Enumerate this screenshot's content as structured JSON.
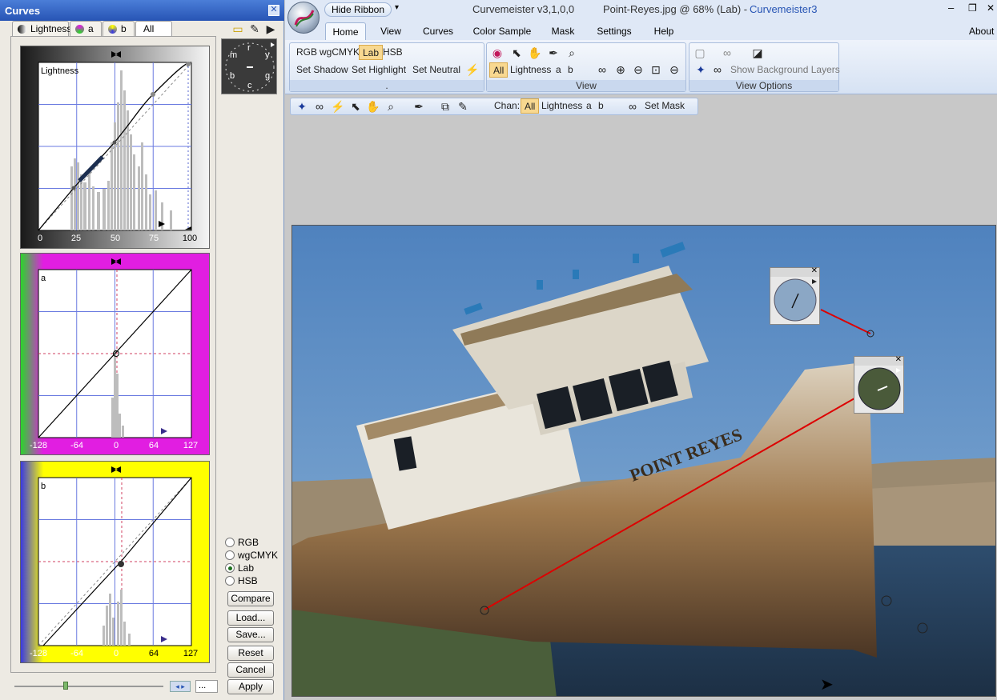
{
  "curves_panel": {
    "title": "Curves",
    "close_glyph": "✕",
    "tabs": [
      {
        "label": "Lightness",
        "icon": "lightness-icon"
      },
      {
        "label": "a",
        "icon": "a-channel-icon"
      },
      {
        "label": "b",
        "icon": "b-channel-icon"
      },
      {
        "label": "All"
      }
    ],
    "lightness_chart": {
      "label": "Lightness",
      "ticks": [
        "0",
        "25",
        "50",
        "75",
        "100"
      ]
    },
    "a_chart": {
      "label": "a",
      "ticks": [
        "-128",
        "-64",
        "0",
        "64",
        "127"
      ]
    },
    "b_chart": {
      "label": "b",
      "ticks": [
        "-128",
        "-64",
        "0",
        "64",
        "127"
      ]
    },
    "dial_letters": [
      "m",
      "r",
      "y",
      "b",
      "c",
      "g"
    ],
    "color_modes": [
      {
        "label": "RGB",
        "selected": false
      },
      {
        "label": "wgCMYK",
        "selected": false
      },
      {
        "label": "Lab",
        "selected": true
      },
      {
        "label": "HSB",
        "selected": false
      }
    ],
    "buttons": {
      "compare": "Compare",
      "load": "Load...",
      "save": "Save...",
      "reset": "Reset",
      "cancel": "Cancel",
      "apply": "Apply"
    },
    "slider_value": "...",
    "accent_colors": {
      "a_frame": "#e11ee1",
      "b_frame": "#ffff00",
      "grid": "#4b5fd8"
    }
  },
  "app": {
    "title": "Curvemeister v3,1,0,0",
    "document": "Point-Reyes.jpg @ 68% (Lab) -",
    "app_name": "Curvemeister3",
    "window_controls": [
      "–",
      "❐",
      "✕"
    ],
    "hide_ribbon": "Hide Ribbon",
    "tabs": [
      "Home",
      "View",
      "Curves",
      "Color Sample",
      "Mask",
      "Settings",
      "Help"
    ],
    "about": "About",
    "group1": {
      "buttons": [
        "RGB",
        "wgCMYK",
        "Lab",
        "HSB"
      ],
      "actions": [
        "Set Shadow",
        "Set Highlight",
        "Set Neutral"
      ],
      "caption": "."
    },
    "group2": {
      "chan_buttons": [
        "All",
        "Lightness",
        "a",
        "b"
      ],
      "caption": "View"
    },
    "group3": {
      "show_bg": "Show Background Layers",
      "caption": "View Options"
    },
    "toolbar": {
      "chan_label": "Chan:",
      "chan_buttons": [
        "All",
        "Lightness",
        "a",
        "b"
      ],
      "set_mask": "Set Mask"
    },
    "image_text": "POINT REYES"
  }
}
